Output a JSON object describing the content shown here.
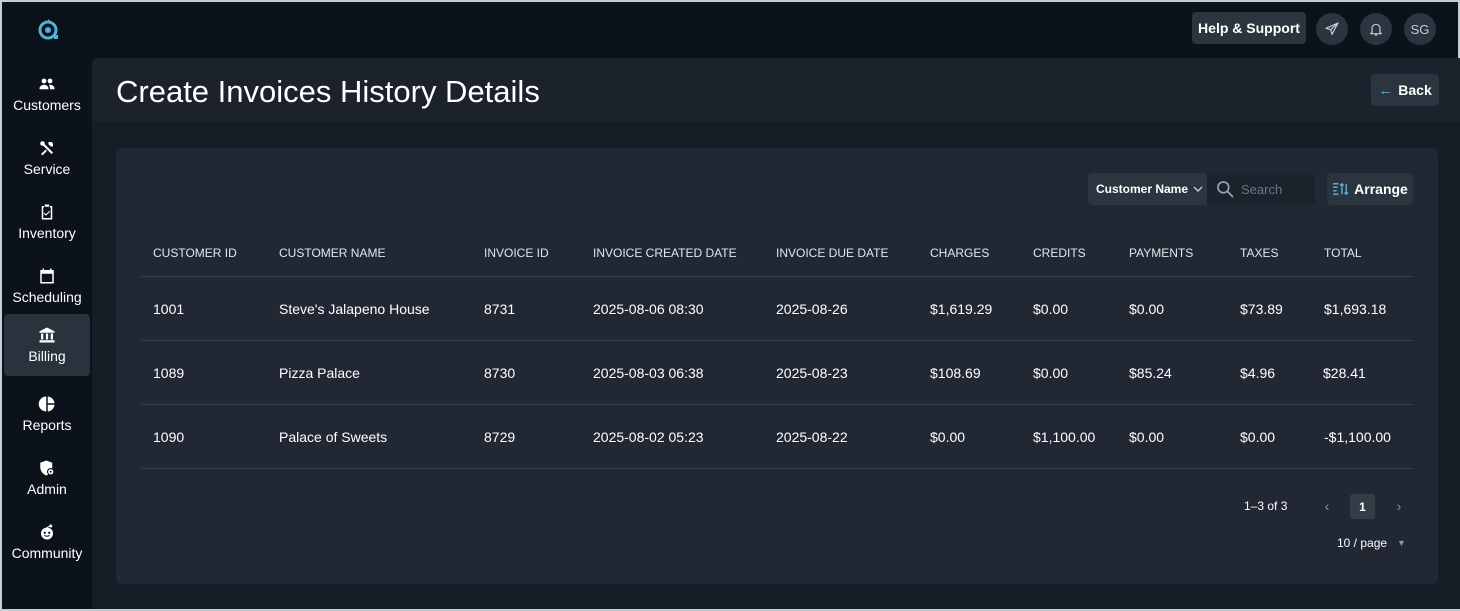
{
  "sidebar": {
    "logo_icon": "app-logo-icon",
    "items": [
      {
        "label": "Customers",
        "icon": "users-icon"
      },
      {
        "label": "Service",
        "icon": "tools-icon"
      },
      {
        "label": "Inventory",
        "icon": "clipboard-check-icon"
      },
      {
        "label": "Scheduling",
        "icon": "calendar-icon"
      },
      {
        "label": "Billing",
        "icon": "bank-icon",
        "active": true
      },
      {
        "label": "Reports",
        "icon": "pie-chart-icon"
      },
      {
        "label": "Admin",
        "icon": "shield-gear-icon"
      },
      {
        "label": "Community",
        "icon": "community-icon"
      }
    ]
  },
  "topbar": {
    "help_label": "Help & Support",
    "send_icon": "paper-plane-icon",
    "bell_icon": "bell-icon",
    "avatar_initials": "SG"
  },
  "header": {
    "title": "Create Invoices History Details",
    "back_label": "Back"
  },
  "toolbar": {
    "filter_label": "Customer Name",
    "search_placeholder": "Search",
    "arrange_label": "Arrange"
  },
  "table": {
    "columns": [
      "CUSTOMER ID",
      "CUSTOMER NAME",
      "INVOICE ID",
      "INVOICE CREATED DATE",
      "INVOICE DUE DATE",
      "CHARGES",
      "CREDITS",
      "PAYMENTS",
      "TAXES",
      "TOTAL"
    ],
    "rows": [
      [
        "1001",
        "Steve's Jalapeno House",
        "8731",
        "2025-08-06 08:30",
        "2025-08-26",
        "$1,619.29",
        "$0.00",
        "$0.00",
        "$73.89",
        "$1,693.18"
      ],
      [
        "1089",
        "Pizza Palace",
        "8730",
        "2025-08-03 06:38",
        "2025-08-23",
        "$108.69",
        "$0.00",
        "$85.24",
        "$4.96",
        "$28.41"
      ],
      [
        "1090",
        "Palace of Sweets",
        "8729",
        "2025-08-02 05:23",
        "2025-08-22",
        "$0.00",
        "$1,100.00",
        "$0.00",
        "$0.00",
        "-$1,100.00"
      ]
    ]
  },
  "pagination": {
    "range_text": "1–3 of 3",
    "current_page": "1",
    "page_size": "10 / page"
  },
  "colors": {
    "accent": "#4fb3d9",
    "background": "#0c1219",
    "panel": "#212833"
  }
}
